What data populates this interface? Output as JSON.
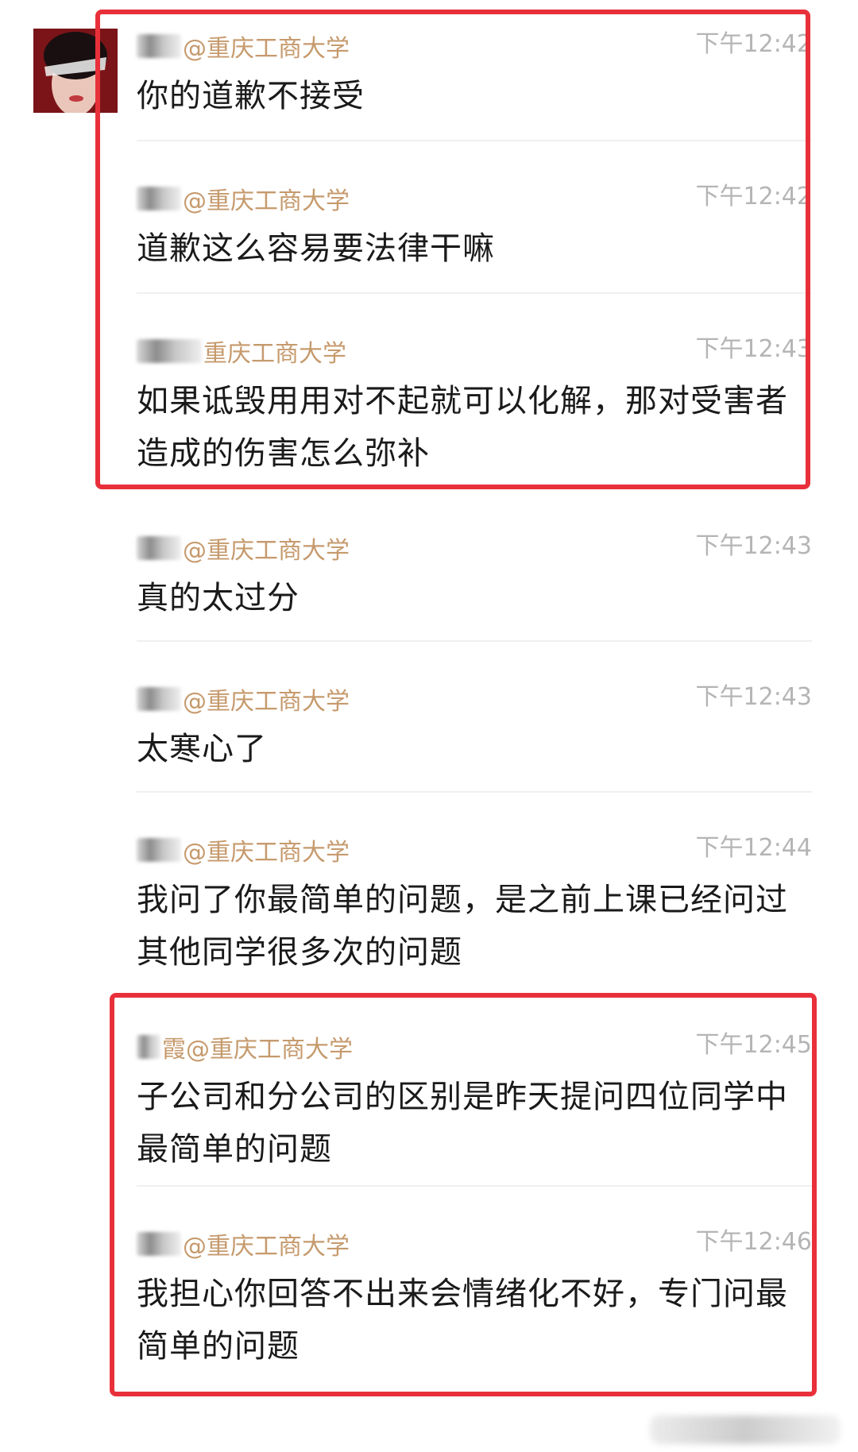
{
  "messages": [
    {
      "sender": "@重庆工商大学",
      "time": "下午12:42",
      "text": "你的道歉不接受"
    },
    {
      "sender": "@重庆工商大学",
      "time": "下午12:42",
      "text": "道歉这么容易要法律干嘛"
    },
    {
      "sender": "重庆工商大学",
      "time": "下午12:43",
      "text": "如果诋毁用用对不起就可以化解，那对受害者造成的伤害怎么弥补"
    },
    {
      "sender": "@重庆工商大学",
      "time": "下午12:43",
      "text": "真的太过分"
    },
    {
      "sender": "@重庆工商大学",
      "time": "下午12:43",
      "text": "太寒心了"
    },
    {
      "sender": "@重庆工商大学",
      "time": "下午12:44",
      "text": "我问了你最简单的问题，是之前上课已经问过其他同学很多次的问题"
    },
    {
      "sender": "霞@重庆工商大学",
      "time": "下午12:45",
      "text": "子公司和分公司的区别是昨天提问四位同学中最简单的问题"
    },
    {
      "sender": "@重庆工商大学",
      "time": "下午12:46",
      "text": "我担心你回答不出来会情绪化不好，专门问最简单的问题"
    }
  ],
  "colors": {
    "sender": "#c69a6d",
    "time": "#b5b5b5",
    "text": "#1a1a1a",
    "highlight": "#e8303a"
  }
}
